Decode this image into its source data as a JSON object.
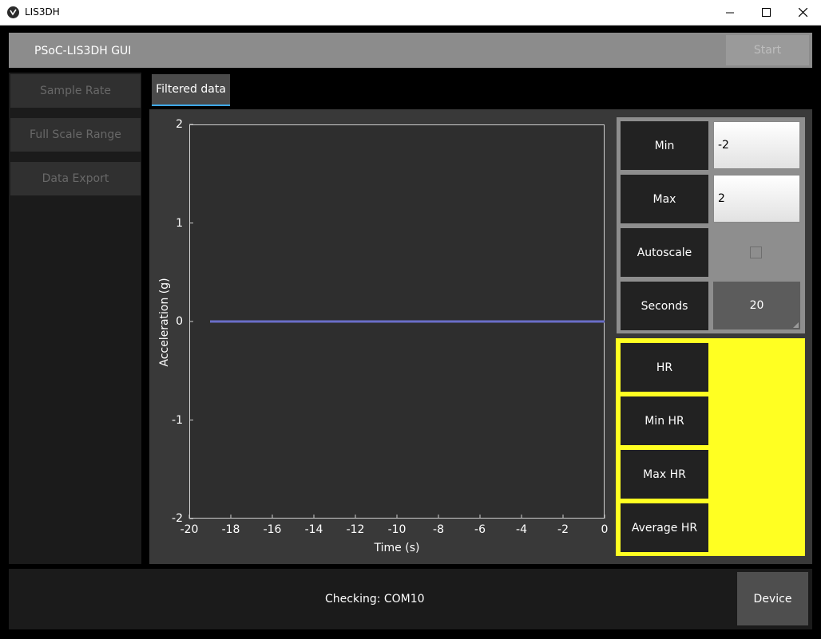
{
  "window": {
    "title": "LIS3DH"
  },
  "header": {
    "app_title": "PSoC-LIS3DH GUI",
    "start_label": "Start"
  },
  "sidebar": {
    "items": [
      {
        "label": "Sample Rate"
      },
      {
        "label": "Full Scale Range"
      },
      {
        "label": "Data Export"
      }
    ]
  },
  "tabs": [
    {
      "label": "Filtered data",
      "active": true
    }
  ],
  "chart_data": {
    "type": "line",
    "title": "",
    "xlabel": "Time (s)",
    "ylabel": "Acceleration (g)",
    "xlim": [
      -20,
      0
    ],
    "ylim": [
      -2,
      2
    ],
    "xticks": [
      "-20",
      "-18",
      "-16",
      "-14",
      "-12",
      "-10",
      "-8",
      "-6",
      "-4",
      "-2",
      "0"
    ],
    "yticks": [
      "2",
      "1",
      "0",
      "-1",
      "-2"
    ],
    "series": [
      {
        "color": "#6a6ec8",
        "x": [
          -19,
          0
        ],
        "y": [
          0,
          0
        ]
      }
    ]
  },
  "controls": {
    "min_label": "Min",
    "min_value": "-2",
    "max_label": "Max",
    "max_value": "2",
    "autoscale_label": "Autoscale",
    "autoscale_checked": false,
    "seconds_label": "Seconds",
    "seconds_value": "20"
  },
  "hr_panel": {
    "hr_label": "HR",
    "min_hr_label": "Min HR",
    "max_hr_label": "Max HR",
    "avg_hr_label": "Average HR"
  },
  "status": {
    "text": "Checking: COM10",
    "device_label": "Device"
  },
  "colors": {
    "hr_panel_bg": "#ffff22",
    "tab_accent": "#3fa9e8",
    "series": "#6a6ec8"
  }
}
